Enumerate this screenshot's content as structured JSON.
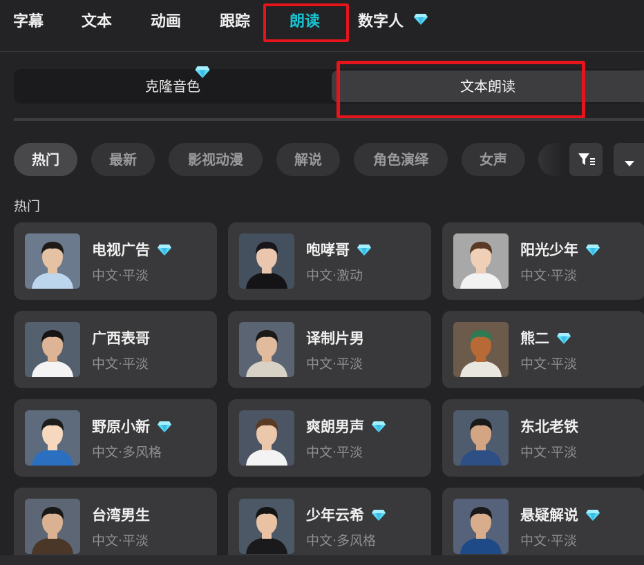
{
  "top_tabs": [
    {
      "label": "字幕"
    },
    {
      "label": "文本"
    },
    {
      "label": "动画"
    },
    {
      "label": "跟踪"
    },
    {
      "label": "朗读"
    },
    {
      "label": "数字人"
    }
  ],
  "segment": {
    "clone_label": "克隆音色",
    "text_read_label": "文本朗读"
  },
  "chips": [
    {
      "label": "热门"
    },
    {
      "label": "最新"
    },
    {
      "label": "影视动漫"
    },
    {
      "label": "解说"
    },
    {
      "label": "角色演绎"
    },
    {
      "label": "女声"
    }
  ],
  "section_title": "热门",
  "voices": [
    {
      "name": "电视广告",
      "desc": "中文·平淡",
      "premium": true
    },
    {
      "name": "咆哮哥",
      "desc": "中文·激动",
      "premium": true
    },
    {
      "name": "阳光少年",
      "desc": "中文·平淡",
      "premium": true
    },
    {
      "name": "广西表哥",
      "desc": "中文·平淡",
      "premium": false
    },
    {
      "name": "译制片男",
      "desc": "中文·平淡",
      "premium": false
    },
    {
      "name": "熊二",
      "desc": "中文·平淡",
      "premium": true
    },
    {
      "name": "野原小新",
      "desc": "中文·多风格",
      "premium": true
    },
    {
      "name": "爽朗男声",
      "desc": "中文·平淡",
      "premium": true
    },
    {
      "name": "东北老铁",
      "desc": "中文·平淡",
      "premium": false
    },
    {
      "name": "台湾男生",
      "desc": "中文·平淡",
      "premium": false
    },
    {
      "name": "少年云希",
      "desc": "中文·多风格",
      "premium": true
    },
    {
      "name": "悬疑解说",
      "desc": "中文·平淡",
      "premium": true
    }
  ],
  "colors": {
    "accent": "#18c2d0",
    "highlight_box": "#e8141b",
    "diamond": "#5ad8f5"
  },
  "icons": {
    "premium": "diamond-icon",
    "filter": "filter-icon",
    "dropdown": "caret-down-icon"
  }
}
